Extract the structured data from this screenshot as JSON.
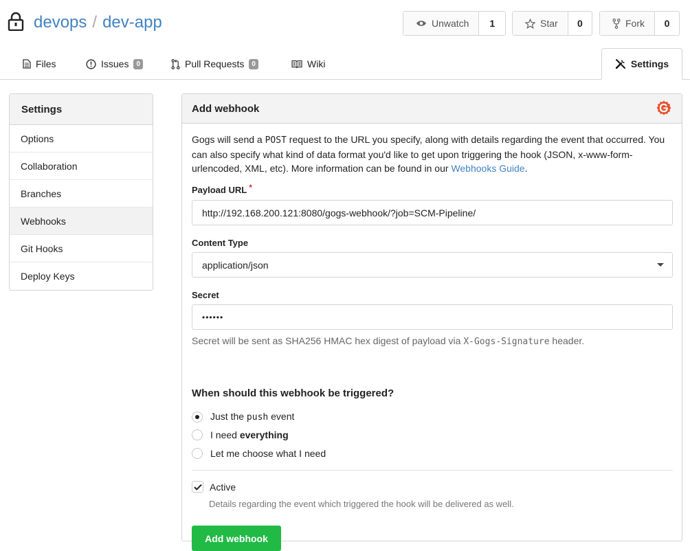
{
  "repo": {
    "owner": "devops",
    "separator": "/",
    "name": "dev-app"
  },
  "actions": {
    "watch": {
      "label": "Unwatch",
      "count": "1"
    },
    "star": {
      "label": "Star",
      "count": "0"
    },
    "fork": {
      "label": "Fork",
      "count": "0"
    }
  },
  "tabs": {
    "files": {
      "label": "Files"
    },
    "issues": {
      "label": "Issues",
      "badge": "0"
    },
    "pulls": {
      "label": "Pull Requests",
      "badge": "0"
    },
    "wiki": {
      "label": "Wiki"
    },
    "settings": {
      "label": "Settings"
    }
  },
  "sidebar": {
    "title": "Settings",
    "items": [
      "Options",
      "Collaboration",
      "Branches",
      "Webhooks",
      "Git Hooks",
      "Deploy Keys"
    ],
    "active": "Webhooks"
  },
  "form": {
    "title": "Add webhook",
    "desc_before": "Gogs will send a ",
    "desc_code": "POST",
    "desc_after": " request to the URL you specify, along with details regarding the event that occurred. You can also specify what kind of data format you'd like to get upon triggering the hook (JSON, x-www-form-urlencoded, XML, etc). More information can be found in our ",
    "desc_link": "Webhooks Guide",
    "desc_end": ".",
    "payload_label": "Payload URL",
    "required_mark": "*",
    "payload_value": "http://192.168.200.121:8080/gogs-webhook/?job=SCM-Pipeline/",
    "content_type_label": "Content Type",
    "content_type_value": "application/json",
    "secret_label": "Secret",
    "secret_value": "••••••",
    "secret_help_before": "Secret will be sent as SHA256 HMAC hex digest of payload via ",
    "secret_help_code": "X-Gogs-Signature",
    "secret_help_after": " header.",
    "trigger_title": "When should this webhook be triggered?",
    "trigger_push_before": "Just the ",
    "trigger_push_code": "push",
    "trigger_push_after": " event",
    "trigger_all_before": "I need ",
    "trigger_all_bold": "everything",
    "trigger_choose": "Let me choose what I need",
    "active_label": "Active",
    "active_help": "Details regarding the event which triggered the hook will be delivered as well.",
    "submit_label": "Add webhook"
  },
  "colors": {
    "link": "#4183c4",
    "submit": "#21ba45",
    "required": "#db2828",
    "gogs_logo": "#e8502e"
  }
}
